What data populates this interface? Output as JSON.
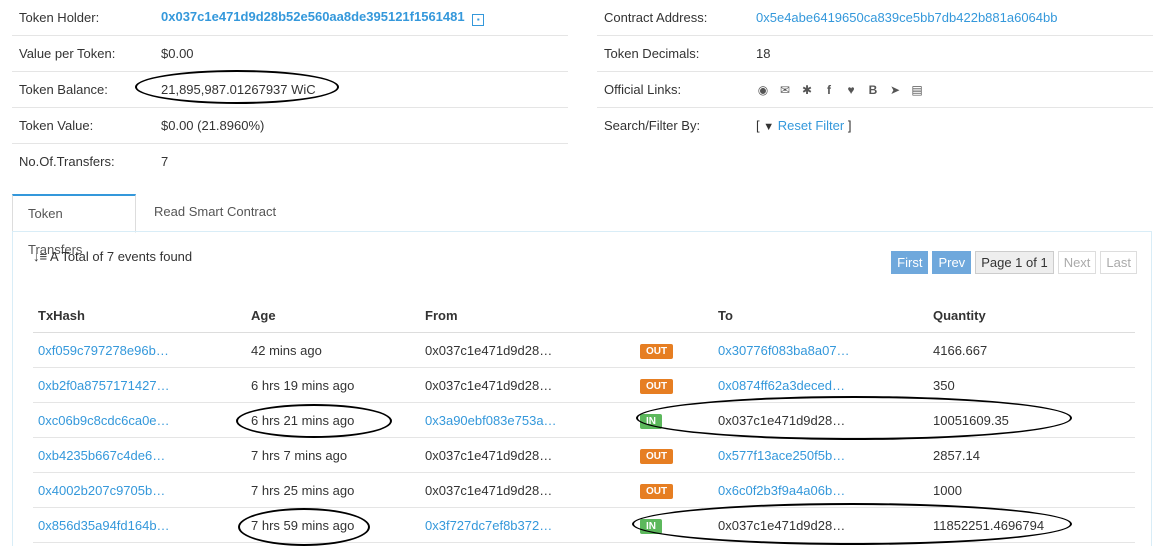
{
  "summary_left": [
    {
      "label": "Token Holder:",
      "value": "0x037c1e471d9d28b52e560aa8de395121f1561481",
      "type": "holder"
    },
    {
      "label": "Value per Token:",
      "value": "$0.00",
      "type": "text"
    },
    {
      "label": "Token Balance:",
      "value": "21,895,987.01267937 WiC",
      "type": "text"
    },
    {
      "label": "Token Value:",
      "value": "$0.00 (21.8960%)",
      "type": "text"
    },
    {
      "label": "No.Of.Transfers:",
      "value": "7",
      "type": "text"
    }
  ],
  "summary_right": {
    "contract_label": "Contract Address:",
    "contract_value": "0x5e4abe6419650ca839ce5bb7db422b881a6064bb",
    "decimals_label": "Token Decimals:",
    "decimals_value": "18",
    "links_label": "Official Links:",
    "filter_label": "Search/Filter By:",
    "filter_open": "[",
    "filter_value": "Reset Filter",
    "filter_close": "]"
  },
  "tabs": [
    "Token Transfers",
    "Read Smart Contract"
  ],
  "total_text": "A Total of 7 events found",
  "pager": {
    "first": "First",
    "prev": "Prev",
    "page_text": "Page 1 of 1",
    "next": "Next",
    "last": "Last"
  },
  "table": {
    "headers": [
      "TxHash",
      "Age",
      "From",
      "",
      "To",
      "Quantity"
    ],
    "rows": [
      {
        "tx": "0xf059c797278e96b…",
        "age": "42 mins ago",
        "from": "0x037c1e471d9d28…",
        "dir": "OUT",
        "to": "0x30776f083ba8a07…",
        "qty": "4166.667"
      },
      {
        "tx": "0xb2f0a8757171427…",
        "age": "6 hrs 19 mins ago",
        "from": "0x037c1e471d9d28…",
        "dir": "OUT",
        "to": "0x0874ff62a3deced…",
        "qty": "350"
      },
      {
        "tx": "0xc06b9c8cdc6ca0e…",
        "age": "6 hrs 21 mins ago",
        "from": "0x3a90ebf083e753a…",
        "dir": "IN",
        "to": "0x037c1e471d9d28…",
        "qty": "10051609.35"
      },
      {
        "tx": "0xb4235b667c4de6…",
        "age": "7 hrs 7 mins ago",
        "from": "0x037c1e471d9d28…",
        "dir": "OUT",
        "to": "0x577f13ace250f5b…",
        "qty": "2857.14"
      },
      {
        "tx": "0x4002b207c9705b…",
        "age": "7 hrs 25 mins ago",
        "from": "0x037c1e471d9d28…",
        "dir": "OUT",
        "to": "0x6c0f2b3f9a4a06b…",
        "qty": "1000"
      },
      {
        "tx": "0x856d35a94fd164b…",
        "age": "7 hrs 59 mins ago",
        "from": "0x3f727dc7ef8b372…",
        "dir": "IN",
        "to": "0x037c1e471d9d28…",
        "qty": "11852251.4696794"
      }
    ]
  }
}
